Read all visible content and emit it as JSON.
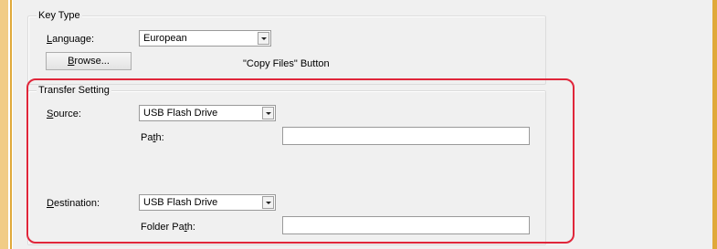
{
  "key_type": {
    "group_label": "Key Type",
    "language_label_prefix": "",
    "language_label_key": "L",
    "language_label_rest": "anguage:",
    "language_value": "European",
    "browse_button_key": "B",
    "browse_button_rest": "rowse...",
    "copy_files_text": "\"Copy Files\" Button"
  },
  "transfer_setting": {
    "group_label": "Transfer Setting",
    "source_label_key": "S",
    "source_label_rest": "ource:",
    "source_value": "USB Flash Drive",
    "path_label_pre": "Pa",
    "path_label_key": "t",
    "path_label_rest": "h:",
    "path_value": "",
    "destination_label_key": "D",
    "destination_label_rest": "estination:",
    "destination_value": "USB Flash Drive",
    "folder_path_label_pre": "Folder Pa",
    "folder_path_label_key": "t",
    "folder_path_label_rest": "h:",
    "folder_path_value": ""
  },
  "colors": {
    "highlight": "#e0263a",
    "panel": "#f0f0f0",
    "accent_orange": "#e0a93a"
  }
}
